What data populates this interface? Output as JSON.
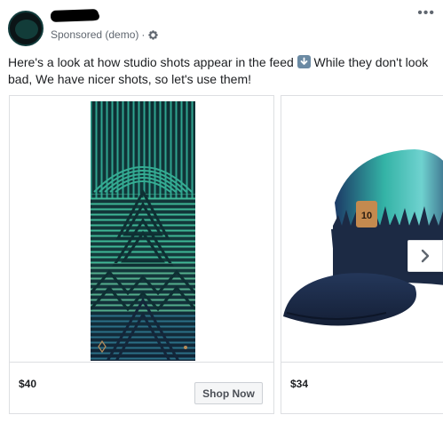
{
  "post": {
    "sponsored_label": "Sponsored (demo)",
    "separator": "·",
    "menu_glyph": "•••",
    "message_part1": "Here's a look at how studio shots appear in the feed ",
    "message_emoji": "down-arrow-emoji",
    "message_part2": " While they don't look bad, We have nicer shots, so let's use them!"
  },
  "carousel": {
    "cards": [
      {
        "price": "$40",
        "cta_label": "Shop Now",
        "image": "towel-product-image"
      },
      {
        "price": "$34",
        "image": "cap-product-image"
      }
    ],
    "next_icon": "chevron-right-icon"
  },
  "colors": {
    "towel_teal": "#2fa38f",
    "towel_dark": "#0f2f3d",
    "towel_navy": "#13263a",
    "cap_navy": "#1c2a44",
    "text_secondary": "#606770",
    "border": "#dddfe2"
  }
}
